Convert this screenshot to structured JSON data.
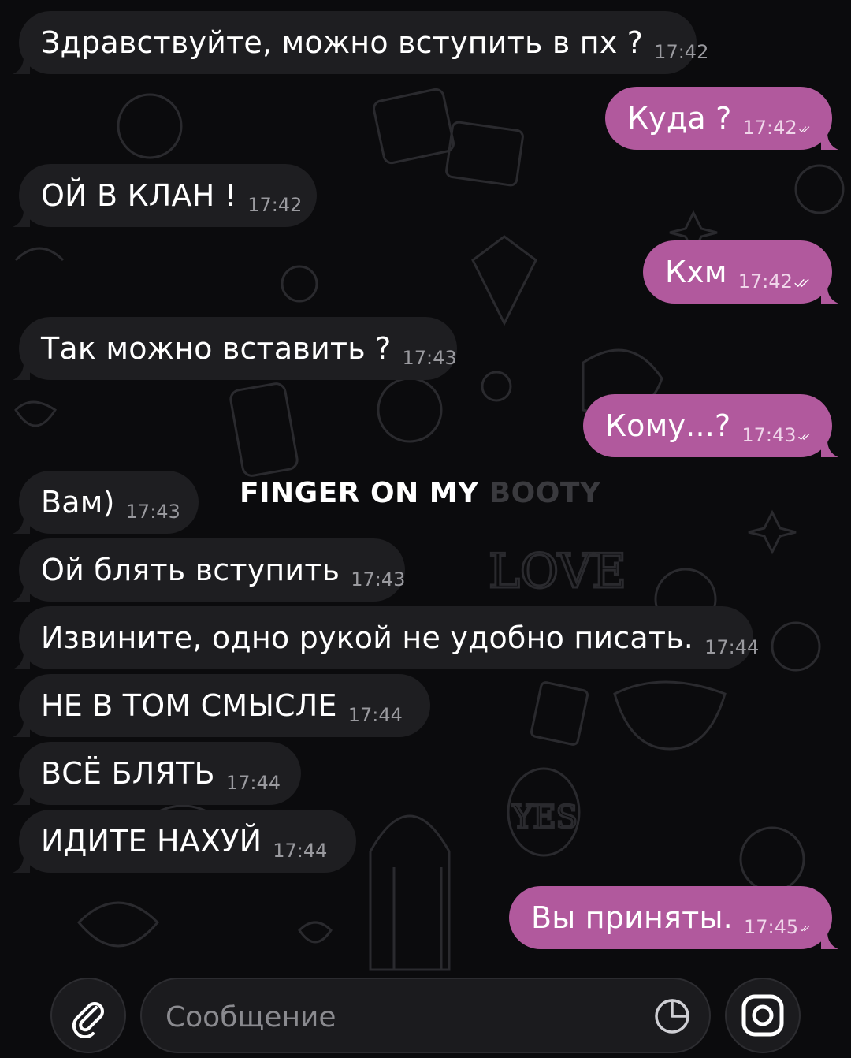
{
  "messages": [
    {
      "dir": "in",
      "text": "Здравствуйте, можно вступить в пх ?",
      "time": "17:42"
    },
    {
      "dir": "out",
      "text": "Куда ?",
      "time": "17:42",
      "read": true
    },
    {
      "dir": "in",
      "text": "ОЙ В КЛАН !",
      "time": "17:42"
    },
    {
      "dir": "out",
      "text": "Кхм",
      "time": "17:42",
      "read": true
    },
    {
      "dir": "in",
      "text": "Так можно вставить ?",
      "time": "17:43"
    },
    {
      "dir": "out",
      "text": "Кому...?",
      "time": "17:43",
      "read": true
    },
    {
      "dir": "in",
      "text": "Вам)",
      "time": "17:43"
    },
    {
      "dir": "in",
      "text": "Ой блять вступить",
      "time": "17:43"
    },
    {
      "dir": "in",
      "text": "Извините, одно рукой не удобно писать.",
      "time": "17:44"
    },
    {
      "dir": "in",
      "text": "НЕ В ТОМ СМЫСЛЕ",
      "time": "17:44"
    },
    {
      "dir": "in",
      "text": "ВСЁ БЛЯТЬ",
      "time": "17:44"
    },
    {
      "dir": "in",
      "text": "ИДИТЕ НАХУЙ",
      "time": "17:44"
    },
    {
      "dir": "out",
      "text": "Вы приняты.",
      "time": "17:45",
      "read": true
    }
  ],
  "overlay": {
    "caption": "FINGER ON MY",
    "caption_faded": "BOOTY"
  },
  "composer": {
    "placeholder": "Сообщение"
  },
  "icons": {
    "attach": "paperclip-icon",
    "sticker": "sticker-icon",
    "camera": "camera-icon",
    "read_receipt": "double-check-icon"
  },
  "colors": {
    "background": "#0b0b0d",
    "incoming_bubble": "#1e1e21",
    "outgoing_bubble": "#b1599d"
  }
}
